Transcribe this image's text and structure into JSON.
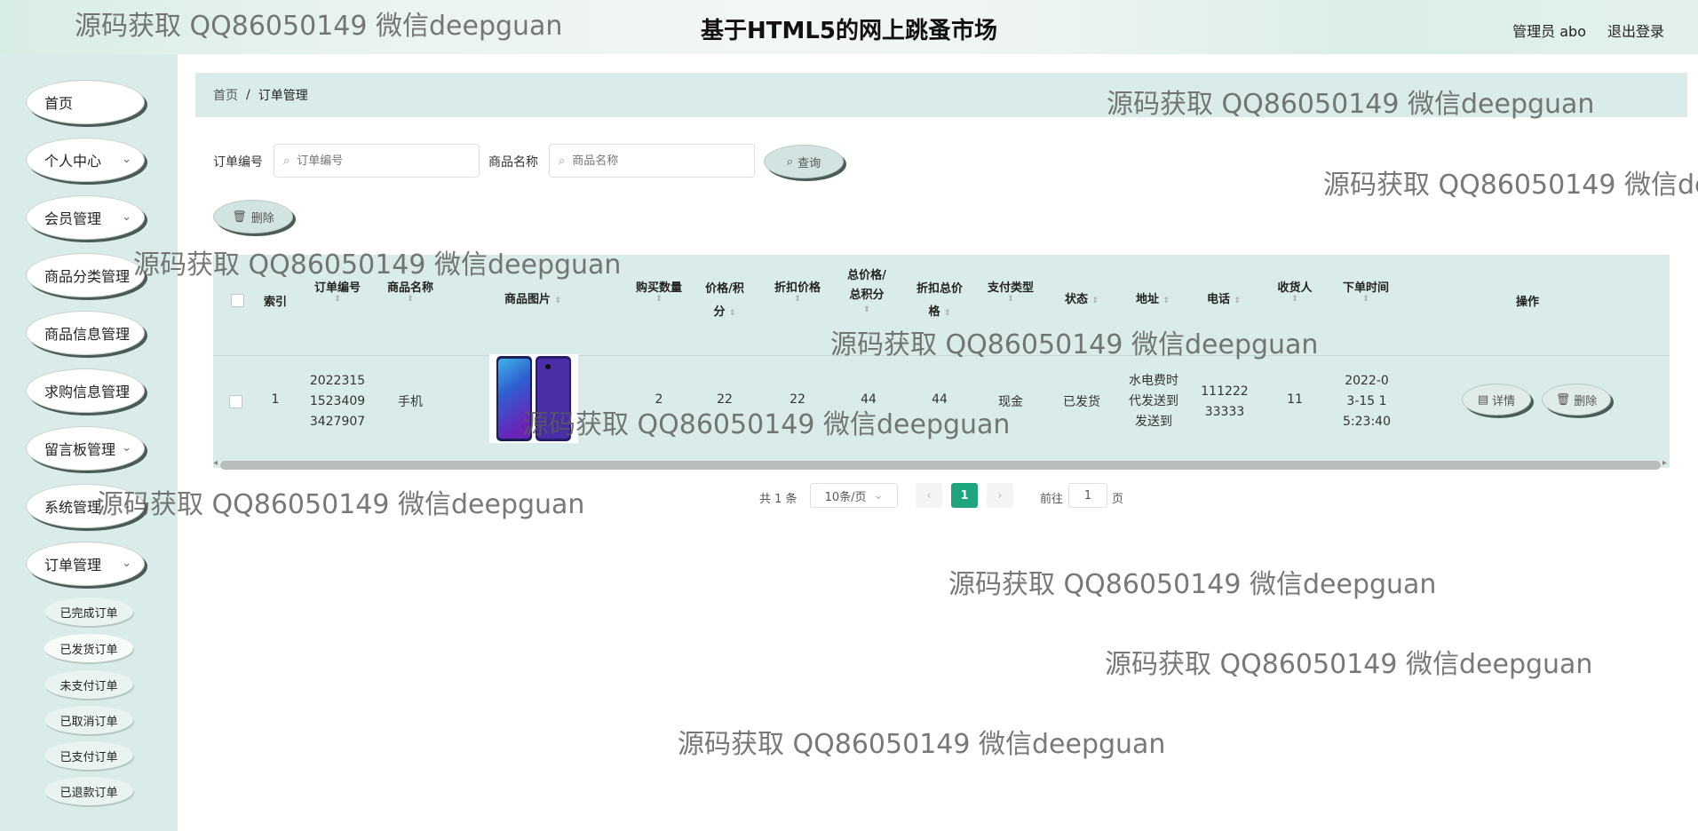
{
  "header": {
    "title": "基于HTML5的网上跳蚤市场",
    "user": "管理员 abo",
    "logout": "退出登录"
  },
  "sidebar": {
    "items": [
      {
        "label": "首页",
        "chevron": ""
      },
      {
        "label": "个人中心",
        "chevron": "⌄"
      },
      {
        "label": "会员管理",
        "chevron": "⌄"
      },
      {
        "label": "商品分类管理",
        "chevron": "⌄"
      },
      {
        "label": "商品信息管理",
        "chevron": "⌄"
      },
      {
        "label": "求购信息管理",
        "chevron": "⌄"
      },
      {
        "label": "留言板管理",
        "chevron": "⌄"
      },
      {
        "label": "系统管理",
        "chevron": "⌄"
      },
      {
        "label": "订单管理",
        "chevron": "⌄"
      }
    ],
    "sub_items": [
      "已完成订单",
      "已发货订单",
      "未支付订单",
      "已取消订单",
      "已支付订单",
      "已退款订单"
    ]
  },
  "breadcrumb": {
    "home": "首页",
    "sep": "/",
    "current": "订单管理"
  },
  "filters": {
    "order_no_label": "订单编号",
    "order_no_placeholder": "订单编号",
    "product_label": "商品名称",
    "product_placeholder": "商品名称",
    "query_button": "查询",
    "delete_button": "删除"
  },
  "table": {
    "headers": {
      "index": "索引",
      "order_no": "订单编号",
      "product": "商品名称",
      "image": "商品图片",
      "qty": "购买数量",
      "price": "价格/积分",
      "discount_price": "折扣价格",
      "total": "总价格/总积分",
      "discount_total": "折扣总价格",
      "pay_type": "支付类型",
      "status": "状态",
      "address": "地址",
      "phone": "电话",
      "receiver": "收货人",
      "order_time": "下单时间",
      "actions": "操作"
    },
    "rows": [
      {
        "index": "1",
        "order_no": "20223151523409 3427907",
        "product": "手机",
        "qty": "2",
        "price": "22",
        "discount_price": "22",
        "total": "44",
        "discount_total": "44",
        "pay_type": "现金",
        "status": "已发货",
        "address": "水电费时代发送到发送到",
        "phone": "11122233333",
        "receiver": "11",
        "order_time": "2022-03-15 15:23:40",
        "detail_btn": "详情",
        "delete_btn": "删除"
      }
    ]
  },
  "pagination": {
    "total": "共 1 条",
    "page_size": "10条/页",
    "prev": "‹",
    "current_page": "1",
    "next": "›",
    "goto_label": "前往",
    "goto_value": "1",
    "page_unit": "页"
  },
  "watermark": "源码获取 QQ86050149 微信deepguan",
  "colors": {
    "sidebar_bg": "#d9ecea",
    "active_page": "#1fa57e",
    "shadow": "#4b5b58"
  }
}
